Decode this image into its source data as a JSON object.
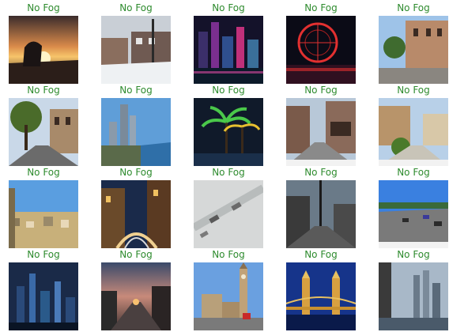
{
  "colors": {
    "label": "#2e8b2e",
    "background": "#ffffff"
  },
  "grid": [
    [
      {
        "label": "No Fog",
        "scene": "sunset-person-icon"
      },
      {
        "label": "No Fog",
        "scene": "snowy-street-icon"
      },
      {
        "label": "No Fog",
        "scene": "neon-city-night-icon"
      },
      {
        "label": "No Fog",
        "scene": "ferris-wheel-night-icon"
      },
      {
        "label": "No Fog",
        "scene": "old-town-square-icon"
      }
    ],
    [
      {
        "label": "No Fog",
        "scene": "tree-lined-street-icon"
      },
      {
        "label": "No Fog",
        "scene": "waterfront-skyline-icon"
      },
      {
        "label": "No Fog",
        "scene": "palm-trees-night-icon"
      },
      {
        "label": "No Fog",
        "scene": "street-view-shops-icon"
      },
      {
        "label": "No Fog",
        "scene": "village-street-icon"
      }
    ],
    [
      {
        "label": "No Fog",
        "scene": "city-panorama-icon"
      },
      {
        "label": "No Fog",
        "scene": "night-road-buildings-icon"
      },
      {
        "label": "No Fog",
        "scene": "snowy-road-cars-icon"
      },
      {
        "label": "No Fog",
        "scene": "street-utility-pole-icon"
      },
      {
        "label": "No Fog",
        "scene": "highway-cars-icon"
      }
    ],
    [
      {
        "label": "No Fog",
        "scene": "city-skyline-night-icon"
      },
      {
        "label": "No Fog",
        "scene": "sunset-street-icon"
      },
      {
        "label": "No Fog",
        "scene": "big-ben-icon"
      },
      {
        "label": "No Fog",
        "scene": "tower-bridge-night-icon"
      },
      {
        "label": "No Fog",
        "scene": "city-towers-dusk-icon"
      }
    ]
  ]
}
